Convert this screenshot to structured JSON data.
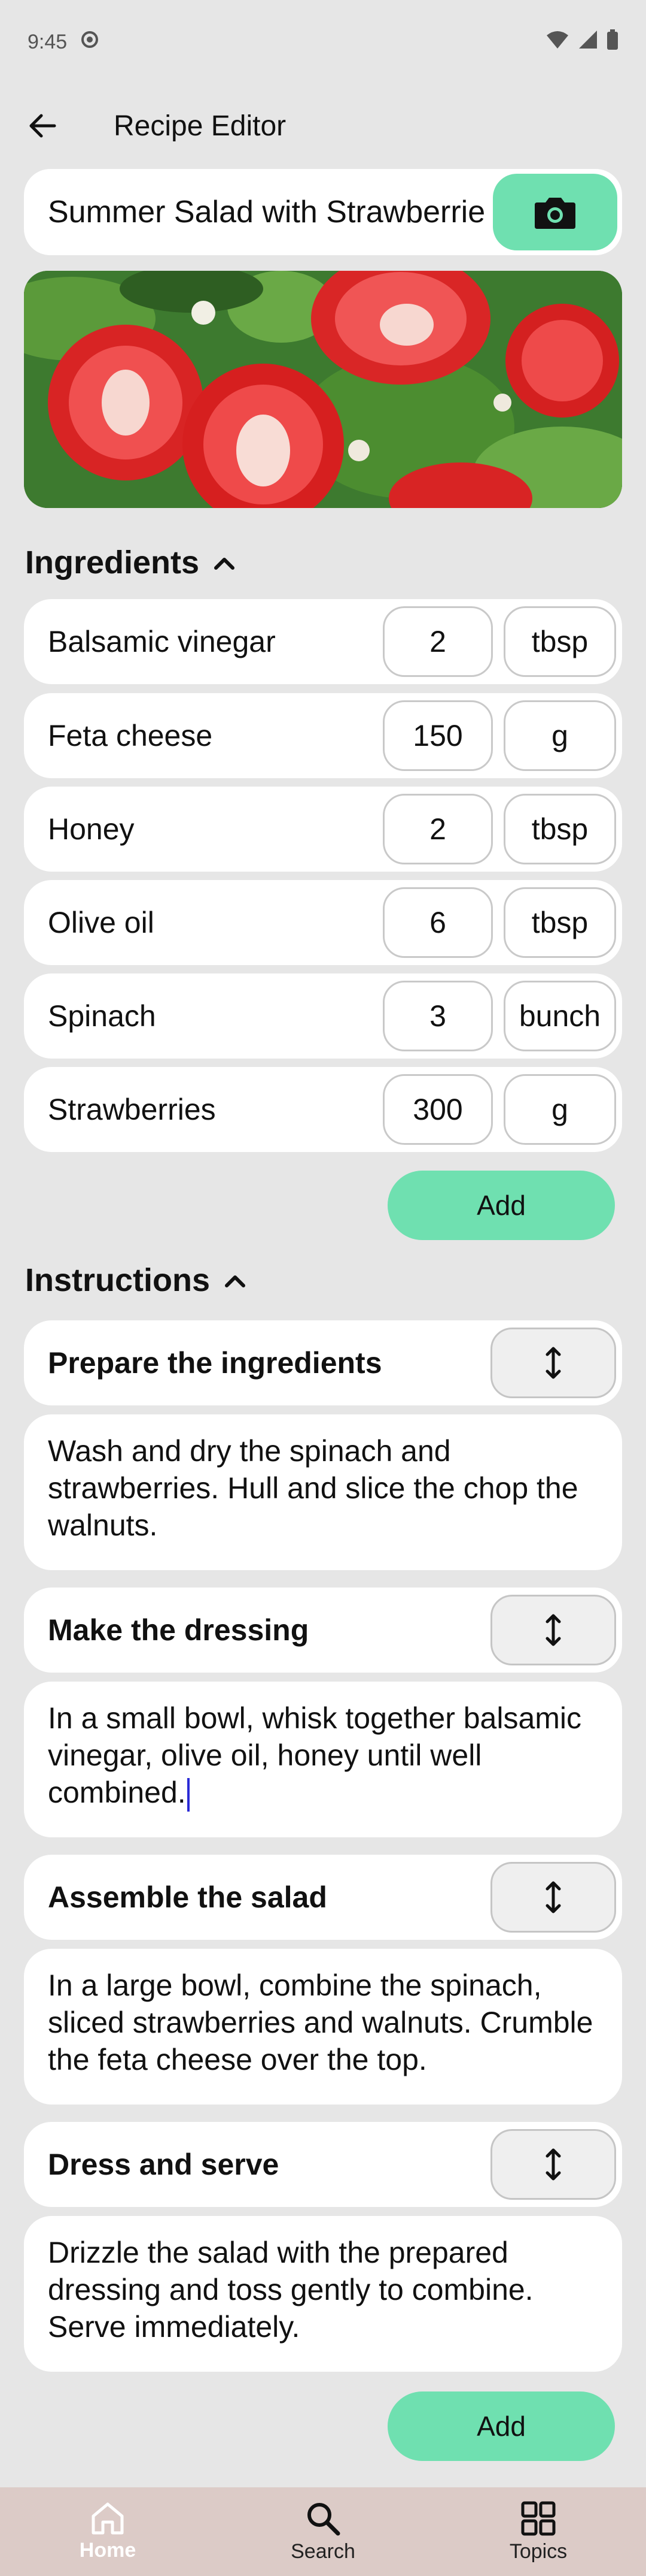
{
  "status": {
    "time": "9:45"
  },
  "app": {
    "title": "Recipe Editor"
  },
  "recipe": {
    "title": "Summer Salad with Strawberrie"
  },
  "ingredients": {
    "header": "Ingredients",
    "items": [
      {
        "name": "Balsamic vinegar",
        "qty": "2",
        "unit": "tbsp"
      },
      {
        "name": "Feta cheese",
        "qty": "150",
        "unit": "g"
      },
      {
        "name": "Honey",
        "qty": "2",
        "unit": "tbsp"
      },
      {
        "name": "Olive oil",
        "qty": "6",
        "unit": "tbsp"
      },
      {
        "name": "Spinach",
        "qty": "3",
        "unit": "bunch"
      },
      {
        "name": "Strawberries",
        "qty": "300",
        "unit": "g"
      }
    ],
    "add_label": "Add"
  },
  "instructions": {
    "header": "Instructions",
    "steps": [
      {
        "title": "Prepare the ingredients",
        "body": "Wash and dry the spinach and strawberries. Hull and slice the chop the walnuts."
      },
      {
        "title": "Make the dressing",
        "body": "In a small bowl, whisk together balsamic vinegar, olive oil, honey until well combined."
      },
      {
        "title": "Assemble the salad",
        "body": "In a large bowl, combine the spinach, sliced strawberries and walnuts. Crumble the feta cheese over the top."
      },
      {
        "title": "Dress and serve",
        "body": "Drizzle the salad with the prepared dressing and toss gently to combine. Serve immediately."
      }
    ],
    "add_label": "Add"
  },
  "nav": {
    "home": "Home",
    "search": "Search",
    "topics": "Topics"
  },
  "colors": {
    "accent": "#6fe0b0",
    "nav_bg": "#dccbc7",
    "background": "#e6e6e6"
  }
}
